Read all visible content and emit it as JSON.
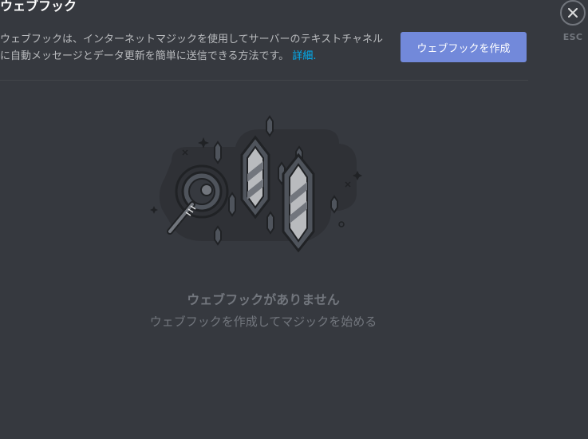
{
  "header": {
    "title": "ウェブフック"
  },
  "description": {
    "text": "ウェブフックは、インターネットマジックを使用してサーバーのテキストチャネルに自動メッセージとデータ更新を簡単に送信できる方法です。",
    "link_label": "詳細."
  },
  "actions": {
    "create_label": "ウェブフックを作成"
  },
  "close": {
    "icon": "close-icon",
    "hint": "ESC"
  },
  "empty_state": {
    "title": "ウェブフックがありません",
    "subtitle": "ウェブフックを作成してマジックを始める"
  },
  "colors": {
    "background": "#36393f",
    "accent": "#7289da",
    "link": "#00b0f4",
    "muted": "#72767d"
  }
}
